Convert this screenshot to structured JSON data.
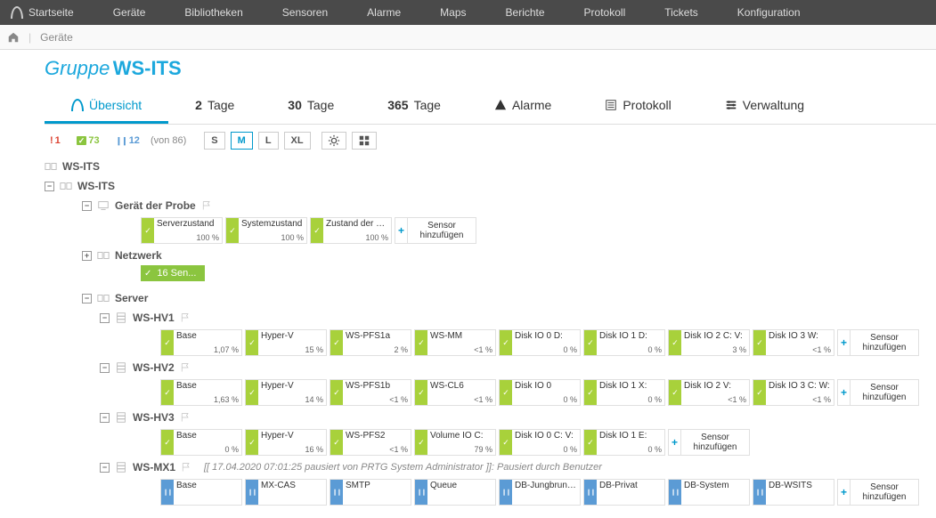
{
  "nav": {
    "items": [
      "Startseite",
      "Geräte",
      "Bibliotheken",
      "Sensoren",
      "Alarme",
      "Maps",
      "Berichte",
      "Protokoll",
      "Tickets",
      "Konfiguration"
    ]
  },
  "breadcrumb": {
    "item": "Geräte"
  },
  "title": {
    "label": "Gruppe",
    "name": "WS-ITS"
  },
  "tabs": [
    {
      "icon": "overview",
      "label": "Übersicht",
      "active": true
    },
    {
      "num": "2",
      "label": "Tage"
    },
    {
      "num": "30",
      "label": "Tage"
    },
    {
      "num": "365",
      "label": "Tage"
    },
    {
      "icon": "alarm",
      "label": "Alarme"
    },
    {
      "icon": "log",
      "label": "Protokoll"
    },
    {
      "icon": "admin",
      "label": "Verwaltung"
    }
  ],
  "toolbar": {
    "alert": "1",
    "ok": "73",
    "paused": "12",
    "of": "(von 86)",
    "sizes": [
      "S",
      "M",
      "L",
      "XL"
    ],
    "activeSize": "M"
  },
  "addSensor": {
    "line1": "Sensor",
    "line2": "hinzufügen"
  },
  "root": {
    "name": "WS-ITS",
    "group": {
      "name": "WS-ITS",
      "nodes": [
        {
          "type": "device",
          "name": "Gerät der Probe",
          "sensors": [
            {
              "s": "ok",
              "n": "Serverzustand",
              "v": "100 %"
            },
            {
              "s": "ok",
              "n": "Systemzustand",
              "v": "100 %"
            },
            {
              "s": "ok",
              "n": "Zustand der Pr...",
              "v": "100 %"
            }
          ],
          "add": true
        },
        {
          "type": "group",
          "name": "Netzwerk",
          "summary": "16 Sen..."
        },
        {
          "type": "group",
          "name": "Server",
          "devices": [
            {
              "name": "WS-HV1",
              "sensors": [
                {
                  "s": "ok",
                  "n": "Base",
                  "v": "1,07 %"
                },
                {
                  "s": "ok",
                  "n": "Hyper-V",
                  "v": "15 %"
                },
                {
                  "s": "ok",
                  "n": "WS-PFS1a",
                  "v": "2 %"
                },
                {
                  "s": "ok",
                  "n": "WS-MM",
                  "v": "<1 %"
                },
                {
                  "s": "ok",
                  "n": "Disk IO 0 D:",
                  "v": "0 %"
                },
                {
                  "s": "ok",
                  "n": "Disk IO 1 D:",
                  "v": "0 %"
                },
                {
                  "s": "ok",
                  "n": "Disk IO 2 C: V:",
                  "v": "3 %"
                },
                {
                  "s": "ok",
                  "n": "Disk IO 3 W:",
                  "v": "<1 %"
                }
              ],
              "add": true
            },
            {
              "name": "WS-HV2",
              "sensors": [
                {
                  "s": "ok",
                  "n": "Base",
                  "v": "1,63 %"
                },
                {
                  "s": "ok",
                  "n": "Hyper-V",
                  "v": "14 %"
                },
                {
                  "s": "ok",
                  "n": "WS-PFS1b",
                  "v": "<1 %"
                },
                {
                  "s": "ok",
                  "n": "WS-CL6",
                  "v": "<1 %"
                },
                {
                  "s": "ok",
                  "n": "Disk IO 0",
                  "v": "0 %"
                },
                {
                  "s": "ok",
                  "n": "Disk IO 1 X:",
                  "v": "0 %"
                },
                {
                  "s": "ok",
                  "n": "Disk IO 2 V:",
                  "v": "<1 %"
                },
                {
                  "s": "ok",
                  "n": "Disk IO 3 C: W:",
                  "v": "<1 %"
                }
              ],
              "add": true
            },
            {
              "name": "WS-HV3",
              "sensors": [
                {
                  "s": "ok",
                  "n": "Base",
                  "v": "0 %"
                },
                {
                  "s": "ok",
                  "n": "Hyper-V",
                  "v": "16 %"
                },
                {
                  "s": "ok",
                  "n": "WS-PFS2",
                  "v": "<1 %"
                },
                {
                  "s": "ok",
                  "n": "Volume IO C:",
                  "v": "79 %"
                },
                {
                  "s": "ok",
                  "n": "Disk IO 0 C: V:",
                  "v": "0 %"
                },
                {
                  "s": "ok",
                  "n": "Disk IO 1 E:",
                  "v": "0 %"
                }
              ],
              "add": true
            },
            {
              "name": "WS-MX1",
              "annot": "[[ 17.04.2020 07:01:25 pausiert von PRTG System Administrator ]]: Pausiert durch Benutzer",
              "sensors": [
                {
                  "s": "paused",
                  "n": "Base",
                  "v": ""
                },
                {
                  "s": "paused",
                  "n": "MX-CAS",
                  "v": ""
                },
                {
                  "s": "paused",
                  "n": "SMTP",
                  "v": ""
                },
                {
                  "s": "paused",
                  "n": "Queue",
                  "v": ""
                },
                {
                  "s": "paused",
                  "n": "DB-Jungbrunn...",
                  "v": ""
                },
                {
                  "s": "paused",
                  "n": "DB-Privat",
                  "v": ""
                },
                {
                  "s": "paused",
                  "n": "DB-System",
                  "v": ""
                },
                {
                  "s": "paused",
                  "n": "DB-WSITS",
                  "v": ""
                }
              ],
              "add": true
            }
          ]
        }
      ]
    }
  }
}
